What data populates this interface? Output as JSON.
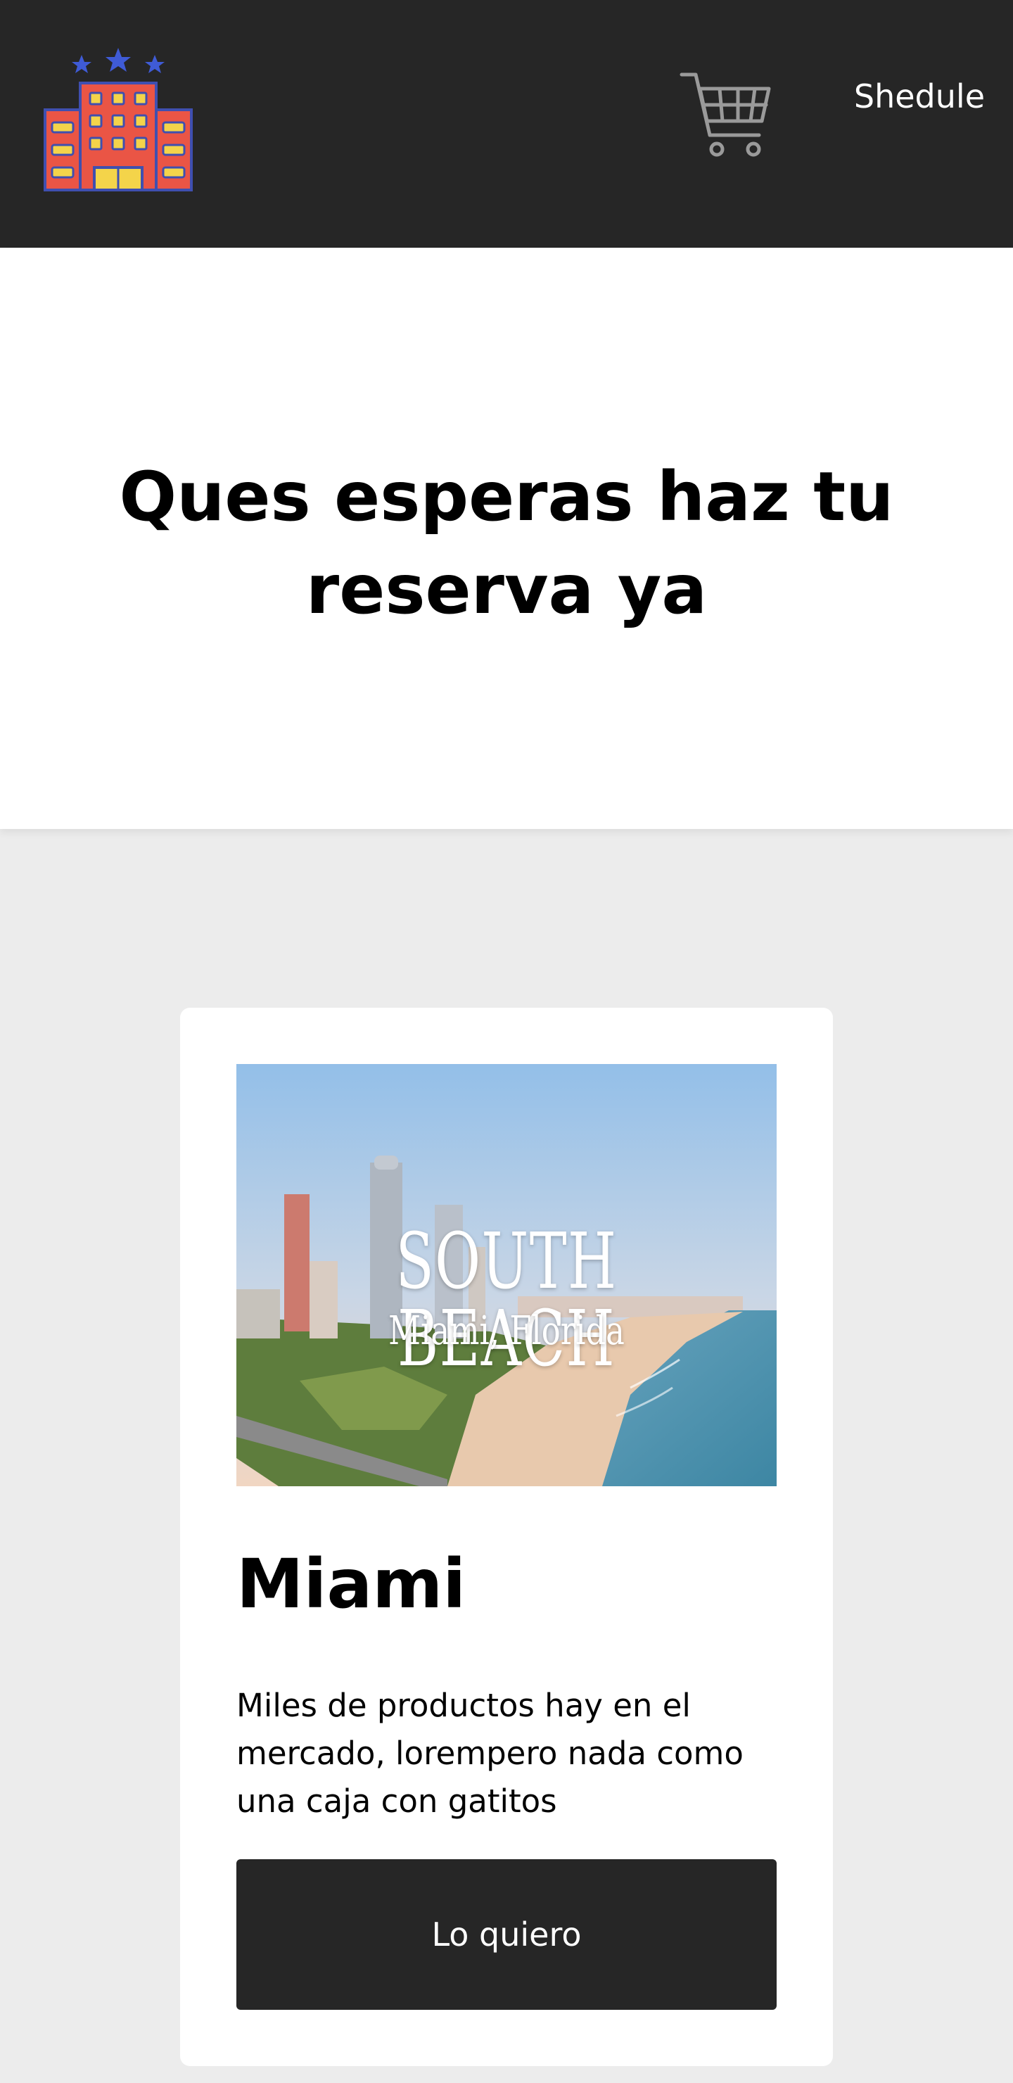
{
  "header": {
    "logo_icon": "hotel-building-icon",
    "cart_icon": "shopping-cart-icon",
    "nav_link": "Shedule",
    "background": "#262626"
  },
  "hero": {
    "title": "Ques esperas haz tu reserva ya"
  },
  "card": {
    "image": {
      "title": "SOUTH BEACH",
      "subtitle": "Miami, Florida"
    },
    "title": "Miami",
    "description": "Miles de productos hay en el mercado, lorempero nada como una caja con gatitos",
    "button_label": "Lo quiero",
    "button_color": "#262626"
  },
  "page": {
    "section_background": "#ececec"
  }
}
